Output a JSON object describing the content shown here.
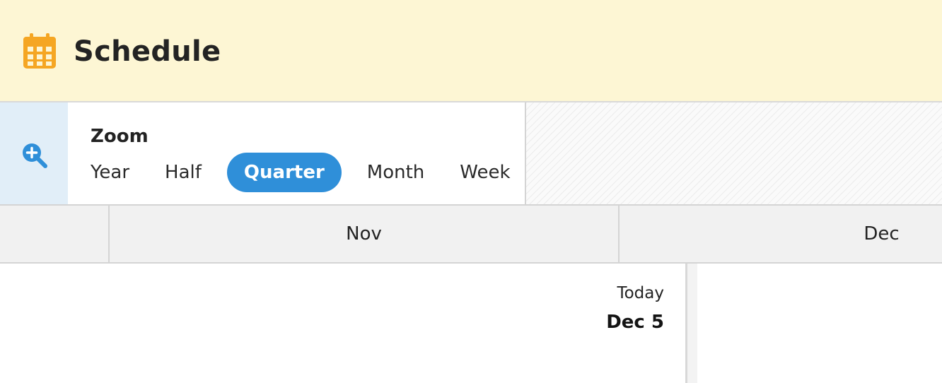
{
  "header": {
    "title": "Schedule",
    "icon": "calendar-icon",
    "accent_color": "#f5a623",
    "background": "#fdf6d4"
  },
  "zoom": {
    "label": "Zoom",
    "icon": "zoom-in-icon",
    "options": [
      "Year",
      "Half",
      "Quarter",
      "Month",
      "Week"
    ],
    "selected": "Quarter",
    "active_color": "#2f8fd9"
  },
  "timeline": {
    "months": [
      "Nov",
      "Dec"
    ],
    "today_label": "Today",
    "today_date": "Dec 5"
  }
}
